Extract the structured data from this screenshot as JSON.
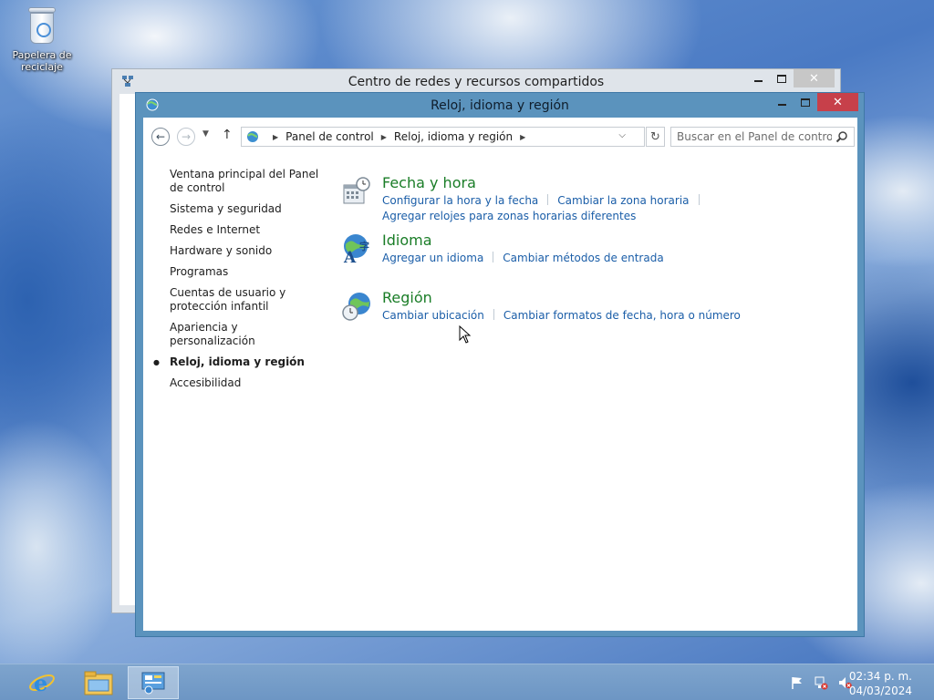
{
  "desktop": {
    "recycle_bin_label": "Papelera de reciclaje"
  },
  "background_window": {
    "title": "Centro de redes y recursos compartidos"
  },
  "window": {
    "title": "Reloj, idioma y región",
    "accent_color": "#5b93bd",
    "close_color": "#c7404a"
  },
  "address": {
    "crumbs": [
      "Panel de control",
      "Reloj, idioma y región"
    ]
  },
  "search": {
    "placeholder": "Buscar en el Panel de control"
  },
  "sidebar": {
    "items": [
      {
        "label": "Ventana principal del Panel de control",
        "current": false
      },
      {
        "label": "Sistema y seguridad",
        "current": false
      },
      {
        "label": "Redes e Internet",
        "current": false
      },
      {
        "label": "Hardware y sonido",
        "current": false
      },
      {
        "label": "Programas",
        "current": false
      },
      {
        "label": "Cuentas de usuario y protección infantil",
        "current": false
      },
      {
        "label": "Apariencia y personalización",
        "current": false
      },
      {
        "label": "Reloj, idioma y región",
        "current": true
      },
      {
        "label": "Accesibilidad",
        "current": false
      }
    ]
  },
  "categories": [
    {
      "title": "Fecha y hora",
      "icon": "calendar-clock-icon",
      "links": [
        "Configurar la hora y la fecha",
        "Cambiar la zona horaria",
        "Agregar relojes para zonas horarias diferentes"
      ]
    },
    {
      "title": "Idioma",
      "icon": "language-globe-icon",
      "links": [
        "Agregar un idioma",
        "Cambiar métodos de entrada"
      ]
    },
    {
      "title": "Región",
      "icon": "region-globe-icon",
      "links": [
        "Cambiar ubicación",
        "Cambiar formatos de fecha, hora o número"
      ]
    }
  ],
  "taskbar": {
    "apps": [
      "internet-explorer-icon",
      "file-explorer-icon",
      "control-panel-icon"
    ],
    "tray_icons": [
      "action-center-flag-icon",
      "network-icon",
      "volume-muted-icon"
    ],
    "time": "02:34 p. m.",
    "date": "04/03/2024"
  }
}
